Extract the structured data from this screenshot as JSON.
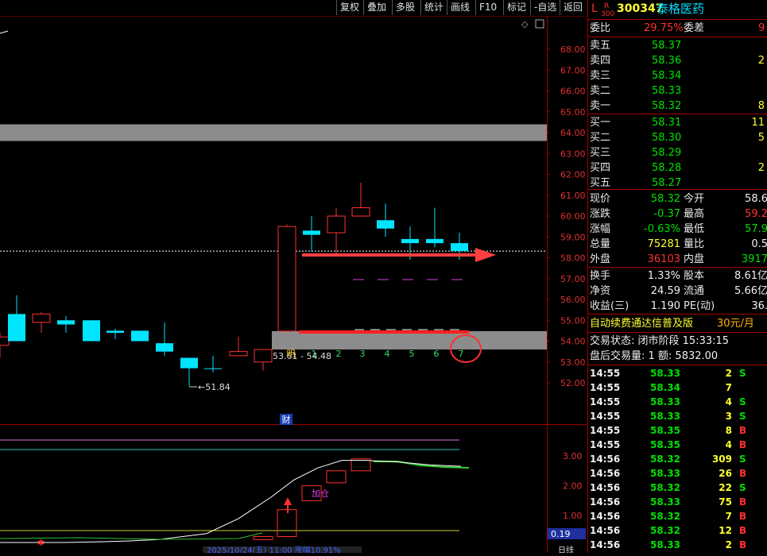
{
  "toolbar": {
    "buttons": [
      "复权",
      "叠加",
      "多股",
      "统计",
      "画线",
      "F10",
      "标记",
      "-自选",
      "返回"
    ]
  },
  "price_axis": [
    "68.00",
    "67.00",
    "66.00",
    "65.00",
    "64.00",
    "63.00",
    "62.00",
    "61.00",
    "60.00",
    "59.00",
    "58.00",
    "57.00",
    "56.00",
    "55.00",
    "54.00",
    "53.00",
    "52.00"
  ],
  "chart_labels": {
    "low_mark": "51.84",
    "range_text": "53.61 - 54.48",
    "day_labels": [
      "明",
      "1",
      "2",
      "3",
      "4",
      "5",
      "6",
      "7"
    ],
    "cai": "财",
    "jiacang": "加仓",
    "bottom_date": "2025/10/24(五) 11:00 涨幅10.91%",
    "indicator_values": [
      "3.00",
      "2.00",
      "1.00"
    ],
    "indicator_current": "0.19",
    "bottom_right": "日线"
  },
  "quote": {
    "tag_L": "L",
    "tag_R": "R",
    "tag_300": "300",
    "code": "300347",
    "name": "泰格医药",
    "weibi_label": "委比",
    "weibi_value": "29.75%",
    "weicha_label": "委差",
    "weicha_value": "9",
    "sells": [
      {
        "label": "卖五",
        "price": "58.37",
        "vol": ""
      },
      {
        "label": "卖四",
        "price": "58.36",
        "vol": "2"
      },
      {
        "label": "卖三",
        "price": "58.34",
        "vol": ""
      },
      {
        "label": "卖二",
        "price": "58.33",
        "vol": ""
      },
      {
        "label": "卖一",
        "price": "58.32",
        "vol": "8"
      }
    ],
    "buys": [
      {
        "label": "买一",
        "price": "58.31",
        "vol": "11"
      },
      {
        "label": "买二",
        "price": "58.30",
        "vol": "5"
      },
      {
        "label": "买三",
        "price": "58.29",
        "vol": ""
      },
      {
        "label": "买四",
        "price": "58.28",
        "vol": "2"
      },
      {
        "label": "买五",
        "price": "58.27",
        "vol": ""
      }
    ],
    "stats": [
      {
        "l1": "现价",
        "v1": "58.32",
        "l2": "今开",
        "v2": "58.6"
      },
      {
        "l1": "涨跌",
        "v1": "-0.37",
        "l2": "最高",
        "v2": "59.2"
      },
      {
        "l1": "涨幅",
        "v1": "-0.63%",
        "l2": "最低",
        "v2": "57.9"
      },
      {
        "l1": "总量",
        "v1": "75281",
        "l2": "量比",
        "v2": "0.5"
      },
      {
        "l1": "外盘",
        "v1": "36103",
        "l2": "内盘",
        "v2": "3917"
      }
    ],
    "stats2": [
      {
        "l1": "换手",
        "v1": "1.33%",
        "l2": "股本",
        "v2": "8.61亿"
      },
      {
        "l1": "净资",
        "v1": "24.59",
        "l2": "流通",
        "v2": "5.66亿"
      },
      {
        "l1": "收益(三)",
        "v1": "1.190",
        "l2": "PE(动)",
        "v2": "36."
      }
    ],
    "promo_text": "自动续费通达信普及版",
    "promo_price": "30元/月",
    "trade_state": "交易状态: 闭市阶段 15:33:15",
    "after_hours": "盘后交易量: 1  额: 5832.00"
  },
  "ticks": [
    {
      "t": "14:55",
      "p": "58.33",
      "v": "2",
      "s": "S"
    },
    {
      "t": "14:55",
      "p": "58.34",
      "v": "7",
      "s": ""
    },
    {
      "t": "14:55",
      "p": "58.33",
      "v": "4",
      "s": "S"
    },
    {
      "t": "14:55",
      "p": "58.33",
      "v": "3",
      "s": "S"
    },
    {
      "t": "14:55",
      "p": "58.35",
      "v": "8",
      "s": "B"
    },
    {
      "t": "14:55",
      "p": "58.35",
      "v": "4",
      "s": "B"
    },
    {
      "t": "14:56",
      "p": "58.32",
      "v": "309",
      "s": "S"
    },
    {
      "t": "14:56",
      "p": "58.33",
      "v": "26",
      "s": "B"
    },
    {
      "t": "14:56",
      "p": "58.32",
      "v": "22",
      "s": "S"
    },
    {
      "t": "14:56",
      "p": "58.33",
      "v": "75",
      "s": "B"
    },
    {
      "t": "14:56",
      "p": "58.32",
      "v": "7",
      "s": "B"
    },
    {
      "t": "14:56",
      "p": "58.32",
      "v": "12",
      "s": "B"
    },
    {
      "t": "14:56",
      "p": "58.33",
      "v": "2",
      "s": "B"
    }
  ],
  "colors": {
    "up": "#ff3030",
    "down": "#00e5ff",
    "frame": "#a00000",
    "band": "#8c8c8c"
  },
  "chart_data": {
    "type": "candlestick",
    "ylim": [
      51.5,
      68.5
    ],
    "candles": [
      {
        "o": 53.8,
        "c": 54.2,
        "h": 54.4,
        "l": 53.2,
        "dir": "up"
      },
      {
        "o": 55.3,
        "c": 54.0,
        "h": 56.2,
        "l": 54.0,
        "dir": "down"
      },
      {
        "o": 54.9,
        "c": 55.3,
        "h": 55.4,
        "l": 54.4,
        "dir": "up"
      },
      {
        "o": 55.0,
        "c": 54.8,
        "h": 55.2,
        "l": 54.4,
        "dir": "down"
      },
      {
        "o": 55.0,
        "c": 54.0,
        "h": 55.0,
        "l": 54.0,
        "dir": "down"
      },
      {
        "o": 54.5,
        "c": 54.4,
        "h": 54.6,
        "l": 54.1,
        "dir": "down"
      },
      {
        "o": 54.5,
        "c": 54.0,
        "h": 54.5,
        "l": 54.0,
        "dir": "down"
      },
      {
        "o": 53.9,
        "c": 53.5,
        "h": 54.9,
        "l": 53.3,
        "dir": "down"
      },
      {
        "o": 53.2,
        "c": 52.7,
        "h": 53.2,
        "l": 51.84,
        "dir": "down"
      },
      {
        "o": 52.7,
        "c": 52.7,
        "h": 53.3,
        "l": 52.5,
        "dir": "down"
      },
      {
        "o": 53.3,
        "c": 53.5,
        "h": 54.2,
        "l": 53.3,
        "dir": "up"
      },
      {
        "o": 53.0,
        "c": 53.6,
        "h": 53.6,
        "l": 52.6,
        "dir": "up"
      },
      {
        "o": 54.48,
        "c": 59.5,
        "h": 59.6,
        "l": 54.48,
        "dir": "up"
      },
      {
        "o": 59.3,
        "c": 59.1,
        "h": 60.0,
        "l": 58.3,
        "dir": "down"
      },
      {
        "o": 59.2,
        "c": 60.0,
        "h": 60.4,
        "l": 58.1,
        "dir": "up"
      },
      {
        "o": 60.0,
        "c": 60.4,
        "h": 61.6,
        "l": 60.0,
        "dir": "up"
      },
      {
        "o": 59.8,
        "c": 59.4,
        "h": 60.6,
        "l": 59.0,
        "dir": "down"
      },
      {
        "o": 58.9,
        "c": 58.7,
        "h": 59.5,
        "l": 57.9,
        "dir": "down"
      },
      {
        "o": 58.9,
        "c": 58.7,
        "h": 60.4,
        "l": 58.5,
        "dir": "down"
      },
      {
        "o": 58.7,
        "c": 58.32,
        "h": 59.2,
        "l": 57.9,
        "dir": "down"
      }
    ],
    "gray_bands": [
      [
        63.6,
        64.4
      ],
      [
        53.6,
        54.48
      ]
    ],
    "dashed_price": 58.32,
    "indicator": {
      "ylim": [
        0,
        3.6
      ],
      "candles": [
        {
          "o": 0.2,
          "c": 0.3
        },
        {
          "o": 0.3,
          "c": 1.2
        },
        {
          "o": 1.5,
          "c": 2.0
        },
        {
          "o": 2.1,
          "c": 2.5
        },
        {
          "o": 2.5,
          "c": 2.9
        }
      ],
      "line": [
        0.1,
        0.1,
        0.1,
        0.12,
        0.15,
        0.2,
        0.4,
        0.9,
        1.6,
        2.2,
        2.6,
        2.85,
        2.85,
        2.8,
        2.7,
        2.65
      ]
    }
  }
}
